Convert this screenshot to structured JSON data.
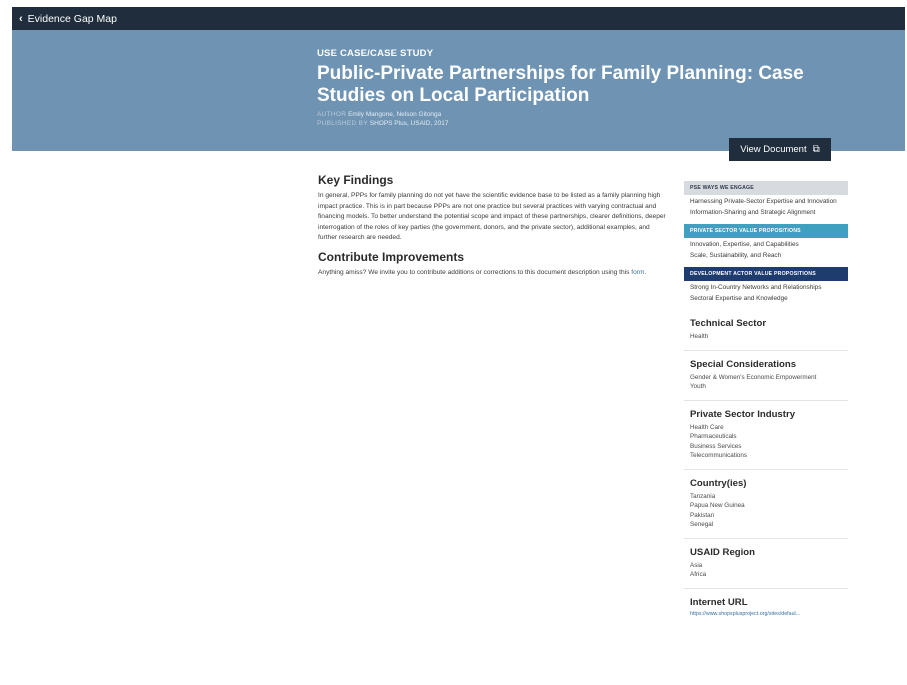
{
  "nav": {
    "back_label": "Evidence Gap Map"
  },
  "hero": {
    "eyebrow": "USE CASE/CASE STUDY",
    "title": "Public-Private Partnerships for Family Planning: Case Studies on Local Participation",
    "author_label": "AUTHOR",
    "authors": "Emily Mangone, Nelson Gitonga",
    "published_label": "PUBLISHED BY",
    "published": "SHOPS Plus, USAID, 2017"
  },
  "view_document_label": "View Document",
  "main": {
    "key_findings_title": "Key Findings",
    "key_findings_text": "In general, PPPs for family planning do not yet have the scientific evidence base to be listed as a family planning high impact practice. This is in part because PPPs are not one practice but several practices with varying contractual and financing models. To better understand the potential scope and impact of these partnerships, clearer definitions, deeper interrogation of the roles of key parties (the government, donors, and the private sector), additional examples, and further research are needed.",
    "contribute_title": "Contribute Improvements",
    "contribute_text": "Anything amiss? We invite you to contribute additions or corrections to this document description using this",
    "contribute_link": "form",
    "contribute_end": "."
  },
  "sidebar": {
    "pse_ways": {
      "heading": "PSE WAYS WE ENGAGE",
      "items": [
        "Harnessing Private-Sector Expertise and Innovation",
        "Information-Sharing and Strategic Alignment"
      ]
    },
    "private_value": {
      "heading": "PRIVATE SECTOR VALUE PROPOSITIONS",
      "items": [
        "Innovation, Expertise, and Capabilities",
        "Scale, Sustainability, and Reach"
      ]
    },
    "dev_value": {
      "heading": "DEVELOPMENT ACTOR VALUE PROPOSITIONS",
      "items": [
        "Strong In-Country Networks and Relationships",
        "Sectoral Expertise and Knowledge"
      ]
    },
    "technical_sector": {
      "title": "Technical Sector",
      "items": [
        "Health"
      ]
    },
    "special_considerations": {
      "title": "Special Considerations",
      "items": [
        "Gender & Women's Economic Empowerment",
        "Youth"
      ]
    },
    "private_sector_industry": {
      "title": "Private Sector Industry",
      "items": [
        "Health Care",
        "Pharmaceuticals",
        "Business Services",
        "Telecommunications"
      ]
    },
    "countries": {
      "title": "Country(ies)",
      "items": [
        "Tanzania",
        "Papua New Guinea",
        "Pakistan",
        "Senegal"
      ]
    },
    "usaid_region": {
      "title": "USAID Region",
      "items": [
        "Asia",
        "Africa"
      ]
    },
    "internet_url": {
      "title": "Internet URL",
      "url": "https://www.shopsplusproject.org/sites/defaul..."
    }
  }
}
